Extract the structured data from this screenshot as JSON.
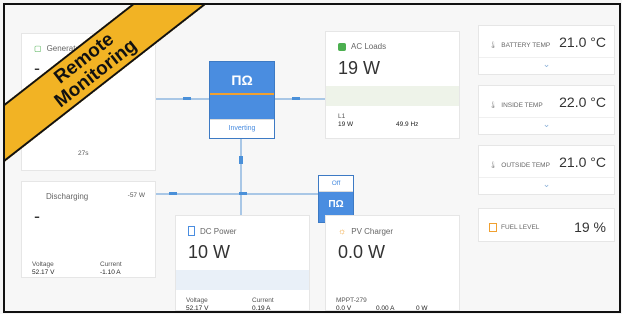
{
  "generator": {
    "title": "Generator",
    "value": "-",
    "fragment": "27s"
  },
  "battery": {
    "title": "Discharging",
    "power": "-57 W",
    "value": "-",
    "voltage_label": "Voltage",
    "voltage_value": "52.17 V",
    "current_label": "Current",
    "current_value": "-1.10 A"
  },
  "inverter": {
    "logo": "ΠΩ",
    "mode": "Inverting"
  },
  "ac_loads": {
    "title": "AC Loads",
    "value": "19 W",
    "phase": "L1",
    "phase_power": "19 W",
    "phase_freq": "49.9 Hz"
  },
  "dc_power": {
    "title": "DC Power",
    "value": "10 W",
    "voltage_label": "Voltage",
    "voltage_value": "52.17 V",
    "current_label": "Current",
    "current_value": "0.19 A"
  },
  "charger": {
    "state": "Off",
    "logo": "ΠΩ"
  },
  "pv": {
    "title": "PV Charger",
    "value": "0.0 W",
    "device": "MPPT-279",
    "v": "0.0 V",
    "a": "0.00 A",
    "w": "0 W"
  },
  "temps": [
    {
      "label": "BATTERY TEMP",
      "value": "21.0 °C"
    },
    {
      "label": "INSIDE TEMP",
      "value": "22.0 °C"
    },
    {
      "label": "OUTSIDE TEMP",
      "value": "21.0 °C"
    }
  ],
  "fuel": {
    "label": "FUEL LEVEL",
    "value": "19 %"
  },
  "banner": {
    "line1": "Remote",
    "line2": "Monitoring"
  },
  "colors": {
    "accent": "#4a8de0",
    "banner": "#f2b324",
    "pv": "#f0a030"
  }
}
